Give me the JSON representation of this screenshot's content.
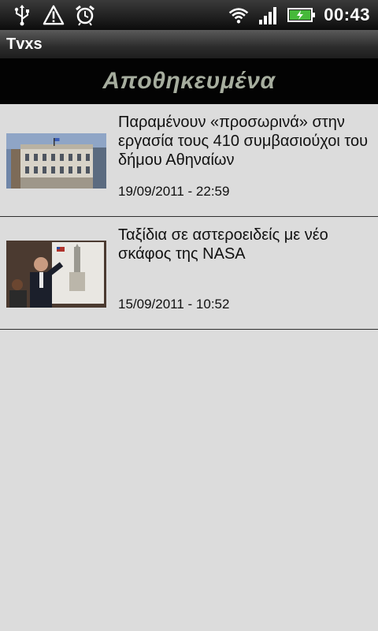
{
  "status_bar": {
    "time": "00:43",
    "icons": [
      "usb-icon",
      "warning-icon",
      "alarm-icon",
      "wifi-icon",
      "signal-icon",
      "battery-charging-icon"
    ]
  },
  "app": {
    "title": "Tvxs"
  },
  "section": {
    "title": "Αποθηκευμένα"
  },
  "articles": [
    {
      "headline": "Παραμένουν «προσωρινά» στην εργασία τους 410 συμβασιούχοι του δήμου Αθηναίων",
      "date": "19/09/2011 - 22:59"
    },
    {
      "headline": "Ταξίδια σε αστεροειδείς με νέο σκάφος της NASA",
      "date": "15/09/2011 - 10:52"
    }
  ],
  "colors": {
    "background": "#dcdcdc",
    "section_title": "#a6ad9e",
    "header_bg": "#030303"
  }
}
